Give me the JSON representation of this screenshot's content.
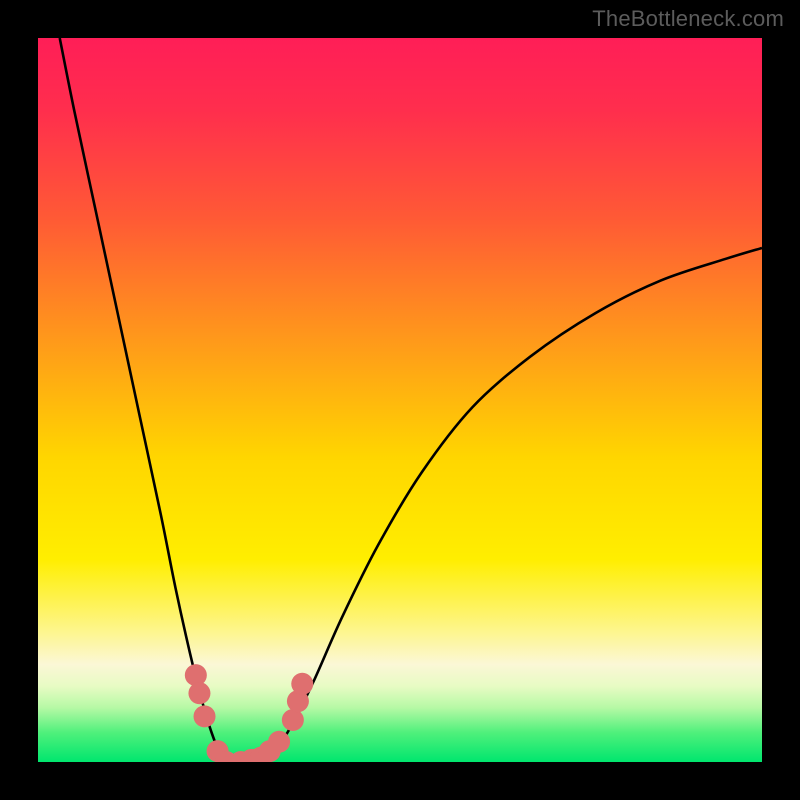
{
  "watermark": "TheBottleneck.com",
  "chart_data": {
    "type": "line",
    "title": "",
    "xlabel": "",
    "ylabel": "",
    "xlim": [
      0,
      100
    ],
    "ylim": [
      0,
      100
    ],
    "background_gradient": {
      "direction": "vertical",
      "stops": [
        {
          "pos": 0.0,
          "color": "#ff1e57"
        },
        {
          "pos": 0.1,
          "color": "#ff2e4d"
        },
        {
          "pos": 0.25,
          "color": "#ff5a35"
        },
        {
          "pos": 0.42,
          "color": "#ff9a1a"
        },
        {
          "pos": 0.58,
          "color": "#ffd600"
        },
        {
          "pos": 0.72,
          "color": "#ffee00"
        },
        {
          "pos": 0.82,
          "color": "#fdf68e"
        },
        {
          "pos": 0.865,
          "color": "#fbf7d6"
        },
        {
          "pos": 0.895,
          "color": "#e8fbc4"
        },
        {
          "pos": 0.925,
          "color": "#b6f9a5"
        },
        {
          "pos": 0.96,
          "color": "#4ef07b"
        },
        {
          "pos": 1.0,
          "color": "#00e66e"
        }
      ]
    },
    "series": [
      {
        "name": "bottleneck-curve",
        "color": "#000000",
        "x": [
          3,
          5,
          8,
          11,
          14,
          17,
          19,
          21,
          22.5,
          24,
          25.5,
          27,
          29,
          31,
          33,
          35,
          38,
          42,
          47,
          53,
          60,
          68,
          77,
          86,
          95,
          100
        ],
        "y": [
          100,
          90,
          76,
          62,
          48,
          34,
          24,
          15,
          9,
          4,
          0.5,
          0,
          0,
          0.5,
          2,
          5,
          11,
          20,
          30,
          40,
          49,
          56,
          62,
          66.5,
          69.5,
          71
        ]
      }
    ],
    "markers": {
      "name": "highlight-dots",
      "color": "#df6f6f",
      "size": 11,
      "points": [
        {
          "x": 21.8,
          "y": 12.0
        },
        {
          "x": 22.3,
          "y": 9.5
        },
        {
          "x": 23.0,
          "y": 6.3
        },
        {
          "x": 24.8,
          "y": 1.5
        },
        {
          "x": 26.0,
          "y": 0.0
        },
        {
          "x": 28.0,
          "y": 0.0
        },
        {
          "x": 29.5,
          "y": 0.3
        },
        {
          "x": 30.8,
          "y": 0.6
        },
        {
          "x": 32.0,
          "y": 1.5
        },
        {
          "x": 33.3,
          "y": 2.8
        },
        {
          "x": 35.2,
          "y": 5.8
        },
        {
          "x": 35.9,
          "y": 8.4
        },
        {
          "x": 36.5,
          "y": 10.8
        }
      ]
    }
  }
}
